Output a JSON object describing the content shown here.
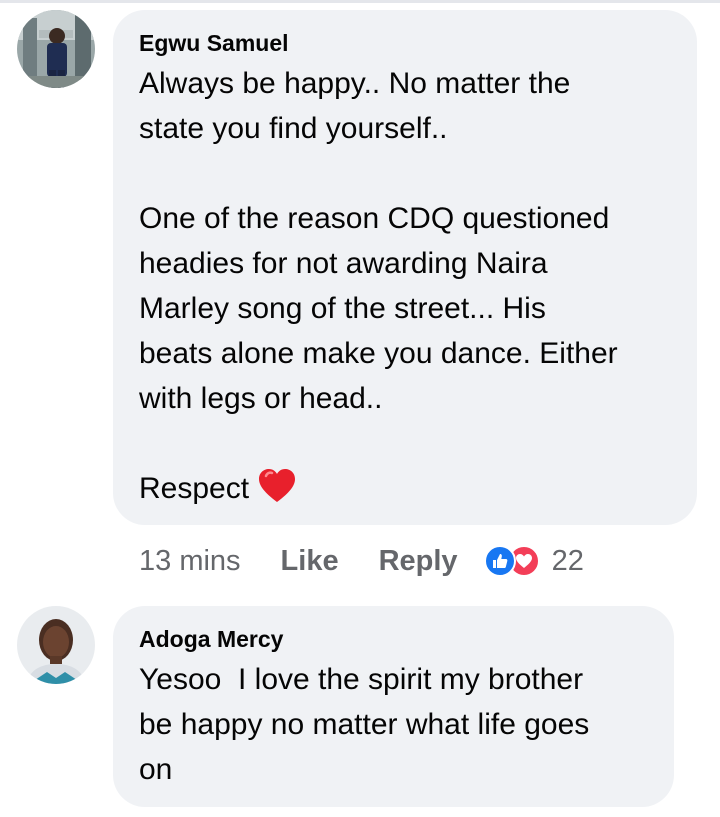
{
  "comments": [
    {
      "author": "Egwu Samuel",
      "lines": [
        "Always be happy.. No matter the",
        "state you find yourself..",
        "",
        "One of the reason CDQ questioned",
        "headies for not awarding Naira",
        "Marley song of the street... His",
        "beats alone make you dance. Either",
        "with legs or head..",
        "",
        "Respect"
      ],
      "reaction_emoji": "red-heart-emoji",
      "time": "13 mins",
      "like_label": "Like",
      "reply_label": "Reply",
      "reaction_icons": [
        "like-icon",
        "love-icon"
      ],
      "reaction_count": "22"
    },
    {
      "author": "Adoga Mercy",
      "lines": [
        "Yesoo  I love the spirit my brother",
        "be happy no matter what life goes",
        "on"
      ]
    }
  ],
  "colors": {
    "bubble": "#f0f2f5",
    "meta_text": "#65676b",
    "like_blue": "#1877f2",
    "love_red": "#f33e58"
  }
}
